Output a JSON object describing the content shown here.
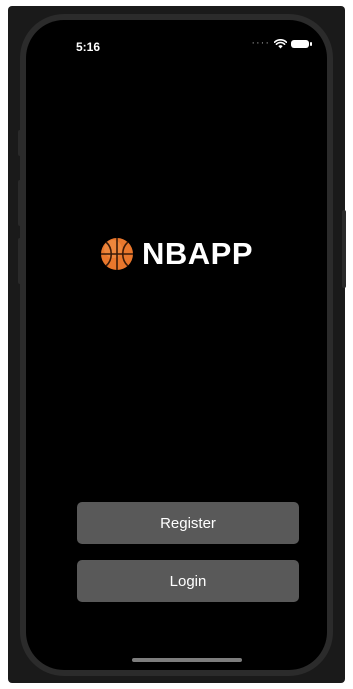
{
  "status_bar": {
    "time": "5:16",
    "signal": "····",
    "wifi_icon": "wifi-icon",
    "battery_icon": "battery-icon"
  },
  "logo": {
    "icon": "basketball-icon",
    "text": "NBAPP"
  },
  "actions": {
    "register_label": "Register",
    "login_label": "Login"
  },
  "colors": {
    "background": "#000000",
    "button": "#595959",
    "text": "#ffffff"
  }
}
